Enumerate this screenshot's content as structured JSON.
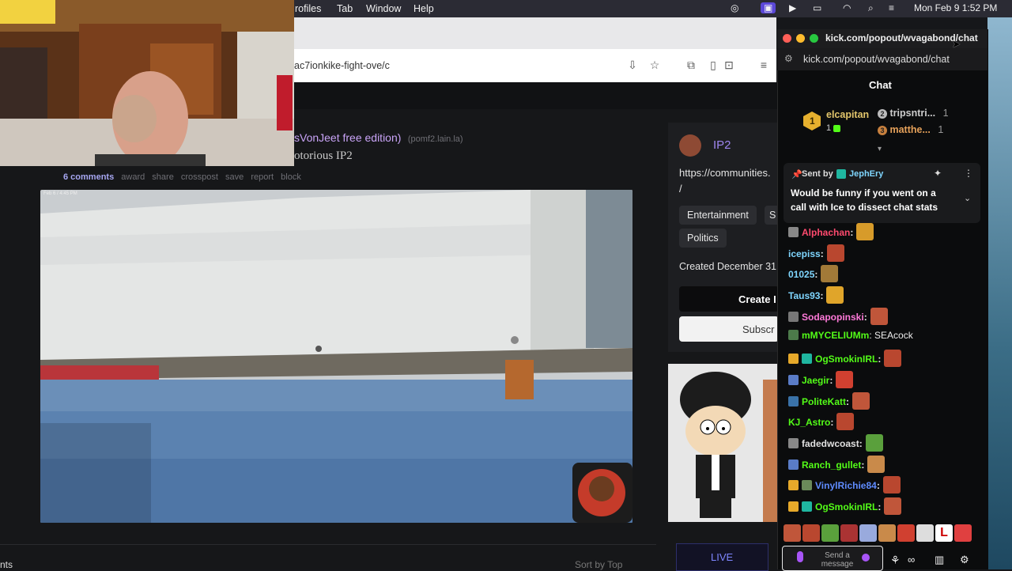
{
  "menubar": {
    "items": [
      "rofiles",
      "Tab",
      "Window",
      "Help"
    ],
    "clock": "Mon Feb 9  1:52 PM"
  },
  "browser": {
    "url": "ac7ionkike-fight-ove/c"
  },
  "post": {
    "title_part": "sVonJeet free edition)",
    "domain": "(pomf2.lain.la)",
    "subtitle": "otorious IP2",
    "actions": [
      "6 comments",
      "award",
      "share",
      "crosspost",
      "save",
      "report",
      "block"
    ],
    "video_timestamp": "Feb 6 / 4:45 PM",
    "sort": "Sort by Top",
    "comments_label": "nts"
  },
  "community": {
    "name": "IP2",
    "link_line1": "https://communities.",
    "link_line2": "/",
    "tags": [
      "Entertainment",
      "S",
      "Politics"
    ],
    "created": "Created December 31",
    "create_btn": "Create I",
    "subscribe_btn": "Subscr",
    "live_btn": "LIVE"
  },
  "chat": {
    "window_url": "kick.com/popout/wvagabond/chat",
    "address": "kick.com/popout/wvagabond/chat",
    "header": "Chat",
    "leaderboard": {
      "top": {
        "rank": "1",
        "name": "elcapitan",
        "count": "1"
      },
      "others": [
        {
          "rank": "2",
          "name": "tripsntri...",
          "count": "1"
        },
        {
          "rank": "3",
          "name": "matthe...",
          "count": "1"
        }
      ]
    },
    "pinned": {
      "sent_by_label": "Sent by",
      "sender": "JephEry",
      "text_line1": "Would be funny if you went on a",
      "text_line2": "call with Ice to dissect chat stats"
    },
    "messages": [
      {
        "user": "Alphachan",
        "text": ":",
        "color": "#ff4a6e"
      },
      {
        "user": "icepiss",
        "text": ":",
        "color": "#7fd6ff"
      },
      {
        "user": "01025",
        "text": ":",
        "color": "#7fd6ff"
      },
      {
        "user": "Taus93",
        "text": ":",
        "color": "#7fd6ff"
      },
      {
        "user": "Sodapopinski",
        "text": ":",
        "color": "#ff7ad9"
      },
      {
        "user": "mMYCELIUMm",
        "text": ": SEAcock",
        "color": "#53fc18"
      },
      {
        "user": "OgSmokinIRL",
        "text": ":",
        "color": "#53fc18"
      },
      {
        "user": "Jaegir",
        "text": ":",
        "color": "#53fc18"
      },
      {
        "user": "PoliteKatt",
        "text": ":",
        "color": "#53fc18"
      },
      {
        "user": "KJ_Astro",
        "text": ":",
        "color": "#53fc18"
      },
      {
        "user": "fadedwcoast",
        "text": ":",
        "color": "#e0e0e0"
      },
      {
        "user": "Ranch_gullet",
        "text": ":",
        "color": "#53fc18"
      },
      {
        "user": "VinylRichie84",
        "text": ":",
        "color": "#5f8cff"
      },
      {
        "user": "OgSmokinIRL",
        "text": ":",
        "color": "#53fc18"
      }
    ],
    "input_placeholder": "Send a message",
    "colors": {
      "kick_green": "#53fc18",
      "bg": "#0b0c0d"
    }
  }
}
